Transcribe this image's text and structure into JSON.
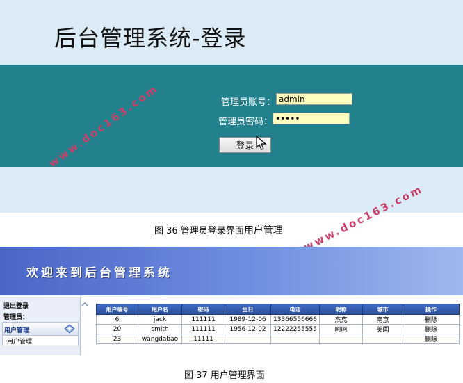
{
  "login": {
    "title": "后台管理系统-登录",
    "account_label": "管理员账号：",
    "account_value": "admin",
    "password_label": "管理员密码：",
    "password_value": "•••••",
    "login_button": "登录"
  },
  "watermark": "www.doc163.com",
  "captions": {
    "fig36_prefix": "图 36  管理员登录界面",
    "fig36_suffix": "用户管理",
    "fig37": "图 37  用户管理界面"
  },
  "admin": {
    "welcome": "欢迎来到后台管理系统",
    "logout": "退出登录",
    "admin_label": "管理员：",
    "menu_group": "用户管理",
    "menu_item": "用户管理"
  },
  "table": {
    "headers": [
      "用户编号",
      "用户名",
      "密码",
      "生日",
      "电话",
      "昵称",
      "城市",
      "操作"
    ],
    "rows": [
      [
        "6",
        "jack",
        "111111",
        "1989-12-06",
        "13366556666",
        "杰克",
        "南京",
        "删除"
      ],
      [
        "20",
        "smith",
        "111111",
        "1956-12-02",
        "12222255555",
        "呵呵",
        "美国",
        "删除"
      ],
      [
        "23",
        "wangdabao",
        "11111",
        "",
        "",
        "",
        "",
        "删除"
      ]
    ]
  },
  "colors": {
    "login_band": "#22818d",
    "login_light": "#dcecf6",
    "input_bg": "#ffffc0",
    "watermark": "#c9406a",
    "admin_header": "#6f8fe0"
  }
}
